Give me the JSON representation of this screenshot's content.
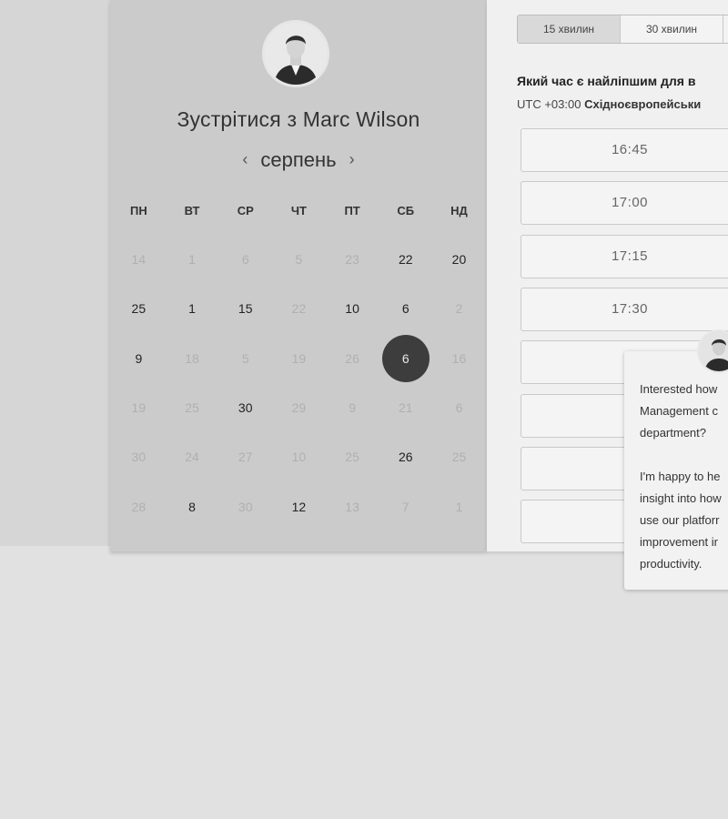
{
  "scheduler": {
    "title": "Зустрітися з Marc Wilson",
    "month": "серпень",
    "prev_icon": "chevron-left-icon",
    "next_icon": "chevron-right-icon",
    "weekdays": [
      "ПН",
      "ВТ",
      "СР",
      "ЧТ",
      "ПТ",
      "СБ",
      "НД"
    ],
    "weeks": [
      [
        {
          "d": "14",
          "dim": true
        },
        {
          "d": "1",
          "dim": true
        },
        {
          "d": "6",
          "dim": true
        },
        {
          "d": "5",
          "dim": true
        },
        {
          "d": "23",
          "dim": true
        },
        {
          "d": "22",
          "dim": false
        },
        {
          "d": "20",
          "dim": false
        }
      ],
      [
        {
          "d": "25",
          "dim": false
        },
        {
          "d": "1",
          "dim": false
        },
        {
          "d": "15",
          "dim": false
        },
        {
          "d": "22",
          "dim": true
        },
        {
          "d": "10",
          "dim": false
        },
        {
          "d": "6",
          "dim": false
        },
        {
          "d": "2",
          "dim": true
        }
      ],
      [
        {
          "d": "9",
          "dim": false
        },
        {
          "d": "18",
          "dim": true
        },
        {
          "d": "5",
          "dim": true
        },
        {
          "d": "19",
          "dim": true
        },
        {
          "d": "26",
          "dim": true
        },
        {
          "d": "6",
          "dim": false,
          "selected": true
        },
        {
          "d": "16",
          "dim": true
        }
      ],
      [
        {
          "d": "19",
          "dim": true
        },
        {
          "d": "25",
          "dim": true
        },
        {
          "d": "30",
          "dim": false
        },
        {
          "d": "29",
          "dim": true
        },
        {
          "d": "9",
          "dim": true
        },
        {
          "d": "21",
          "dim": true
        },
        {
          "d": "6",
          "dim": true
        }
      ],
      [
        {
          "d": "30",
          "dim": true
        },
        {
          "d": "24",
          "dim": true
        },
        {
          "d": "27",
          "dim": true
        },
        {
          "d": "10",
          "dim": true
        },
        {
          "d": "25",
          "dim": true
        },
        {
          "d": "26",
          "dim": false
        },
        {
          "d": "25",
          "dim": true
        }
      ],
      [
        {
          "d": "28",
          "dim": true
        },
        {
          "d": "8",
          "dim": false
        },
        {
          "d": "30",
          "dim": true
        },
        {
          "d": "12",
          "dim": false
        },
        {
          "d": "13",
          "dim": true
        },
        {
          "d": "7",
          "dim": true
        },
        {
          "d": "1",
          "dim": true
        }
      ]
    ]
  },
  "booking": {
    "durations": [
      {
        "label": "15 хвилин",
        "active": true
      },
      {
        "label": "30 хвилин",
        "active": false
      },
      {
        "label": "",
        "active": false
      }
    ],
    "question": "Який час є найліпшим для в",
    "timezone_offset": "UTC +03:00",
    "timezone_name": "Східноєвропейськи",
    "slots": [
      "16:45",
      "17:00",
      "17:15",
      "17:30",
      "",
      "",
      "",
      ""
    ]
  },
  "chat": {
    "message": "Interested how\nManagement c\ndepartment?\n\nI'm happy to he\ninsight into how\nuse our platforr\nimprovement ir\nproductivity."
  }
}
